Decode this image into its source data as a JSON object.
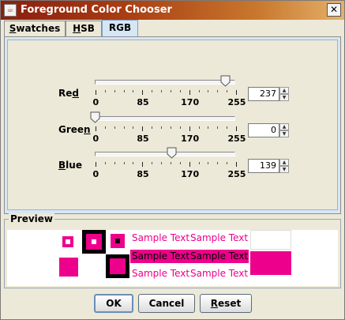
{
  "window": {
    "title": "Foreground Color Chooser",
    "close_glyph": "✕"
  },
  "tabs": [
    {
      "label": "Swatches",
      "mnemonic": "S",
      "rest": "watches"
    },
    {
      "label": "HSB",
      "mnemonic": "H",
      "rest": "SB"
    },
    {
      "label": "RGB",
      "mnemonic": "",
      "rest": "RGB",
      "active": true
    }
  ],
  "sliders": [
    {
      "name": "Red",
      "pre": "Re",
      "mnemonic": "d",
      "post": "",
      "value": 237,
      "max": 255,
      "ticks": [
        "0",
        "85",
        "170",
        "255"
      ]
    },
    {
      "name": "Green",
      "pre": "Gree",
      "mnemonic": "n",
      "post": "",
      "value": 0,
      "max": 255,
      "ticks": [
        "0",
        "85",
        "170",
        "255"
      ]
    },
    {
      "name": "Blue",
      "pre": "",
      "mnemonic": "B",
      "post": "lue",
      "value": 139,
      "max": 255,
      "ticks": [
        "0",
        "85",
        "170",
        "255"
      ]
    }
  ],
  "preview": {
    "legend": "Preview",
    "sample_text": "Sample Text",
    "color": "#ed008b"
  },
  "buttons": {
    "ok": {
      "label": "OK"
    },
    "cancel": {
      "label": "Cancel"
    },
    "reset": {
      "pre": "",
      "mnemonic": "R",
      "post": "eset"
    }
  },
  "colors": {
    "accent": "#ed008b",
    "panel": "#ece9d8",
    "tab_active": "#d6e6f5"
  }
}
